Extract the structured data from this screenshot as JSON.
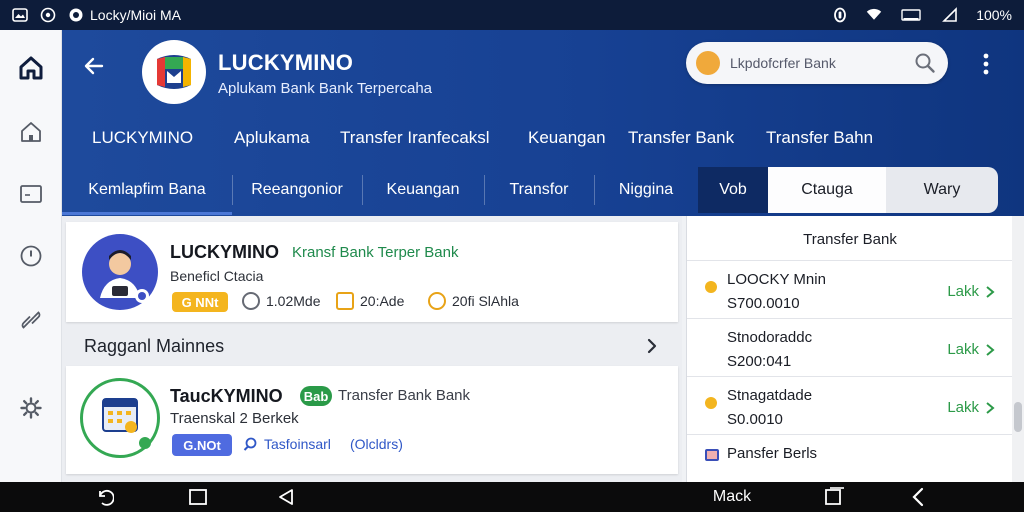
{
  "status_bar": {
    "app_text": "Locky/Mioi MA",
    "battery": "100%",
    "icons": [
      "image-icon",
      "whatsapp-icon",
      "notification-icon",
      "wifi-icon",
      "battery-icon",
      "signal-icon"
    ]
  },
  "left_rail": {
    "items": [
      "home-filled-icon",
      "home-outline-icon",
      "tablet-icon",
      "clock-icon",
      "link-icon",
      "settings-icon"
    ]
  },
  "header": {
    "title": "LUCKYMINO",
    "subtitle": "Aplukam Bank Bank Terpercaha",
    "search_placeholder": "Lkpdofcrfer Bank"
  },
  "nav_primary": {
    "items": [
      "LUCKYMINO",
      "Aplukama",
      "Transfer Iranfecaksl",
      "Keuangan",
      "Transfer Bank",
      "Transfer Bahn"
    ]
  },
  "nav_secondary": {
    "items": [
      "Kemlapfim Bana",
      "Reeangonior",
      "Keuangan",
      "Transfor",
      "Niggina",
      "Vob",
      "Ctauga",
      "Wary"
    ]
  },
  "main": {
    "card1": {
      "title": "LUCKYMINO",
      "tag": "Kransf Bank Terper Bank",
      "subtitle": "Beneficl Ctacia",
      "pill": "G NNt",
      "meta": [
        "1.02Mde",
        "20:Ade",
        "20fi SlAhla"
      ]
    },
    "section_label": "Ragganl Mainnes",
    "card2": {
      "title": "TaucKYMINO",
      "badge": "Bab",
      "tag": "Transfer Bank Bank",
      "subtitle": "Traenskal 2 Berkek",
      "pill": "G.NOt",
      "meta": [
        "Tasfoinsarl",
        "(Olcldrs)"
      ]
    }
  },
  "right_panel": {
    "title": "Transfer Bank",
    "rows": [
      {
        "name": "LOOCKY Mnin",
        "amount": "S700.0010",
        "link": "Lakk"
      },
      {
        "name": "Stnodoraddc",
        "amount": "S200:041",
        "link": "Lakk"
      },
      {
        "name": "Stnagatdade",
        "amount": "S0.0010",
        "link": "Lakk"
      },
      {
        "name": "Pansfer Berls",
        "amount": "",
        "link": ""
      }
    ]
  },
  "bottom_bar": {
    "label": "Mack"
  },
  "colors": {
    "header_blue": "#1e4a9c",
    "accent_green": "#2c9a48",
    "accent_yellow": "#f3b51f"
  }
}
